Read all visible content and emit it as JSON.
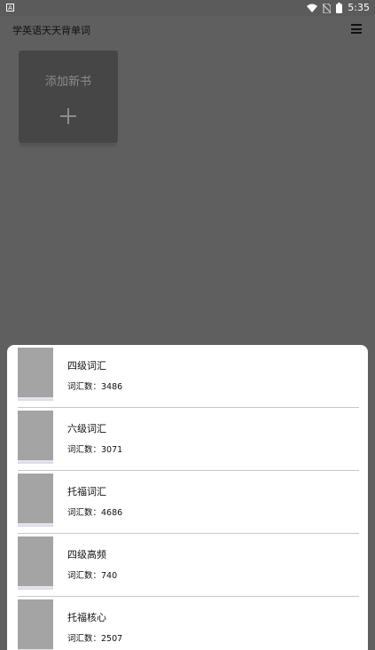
{
  "status_bar": {
    "app_icon_letter": "A",
    "time": "5:35",
    "icons": [
      "wifi-icon",
      "no-sim-icon",
      "battery-icon"
    ]
  },
  "app_bar": {
    "title": "学英语天天背单词",
    "menu_icon": "hamburger-menu-icon"
  },
  "add_book": {
    "label": "添加新书",
    "icon": "plus-icon"
  },
  "book_list": {
    "items": [
      {
        "name": "四级词汇",
        "count": "词汇数：3486"
      },
      {
        "name": "六级词汇",
        "count": "词汇数：3071"
      },
      {
        "name": "托福词汇",
        "count": "词汇数：4686"
      },
      {
        "name": "四级高频",
        "count": "词汇数：740"
      },
      {
        "name": "托福核心",
        "count": "词汇数：2507"
      }
    ]
  },
  "colors": {
    "overlay_bg": "#5f5f5f",
    "card_bg": "#464646",
    "sheet_bg": "#ffffff",
    "cover": "#a4a4a4"
  }
}
